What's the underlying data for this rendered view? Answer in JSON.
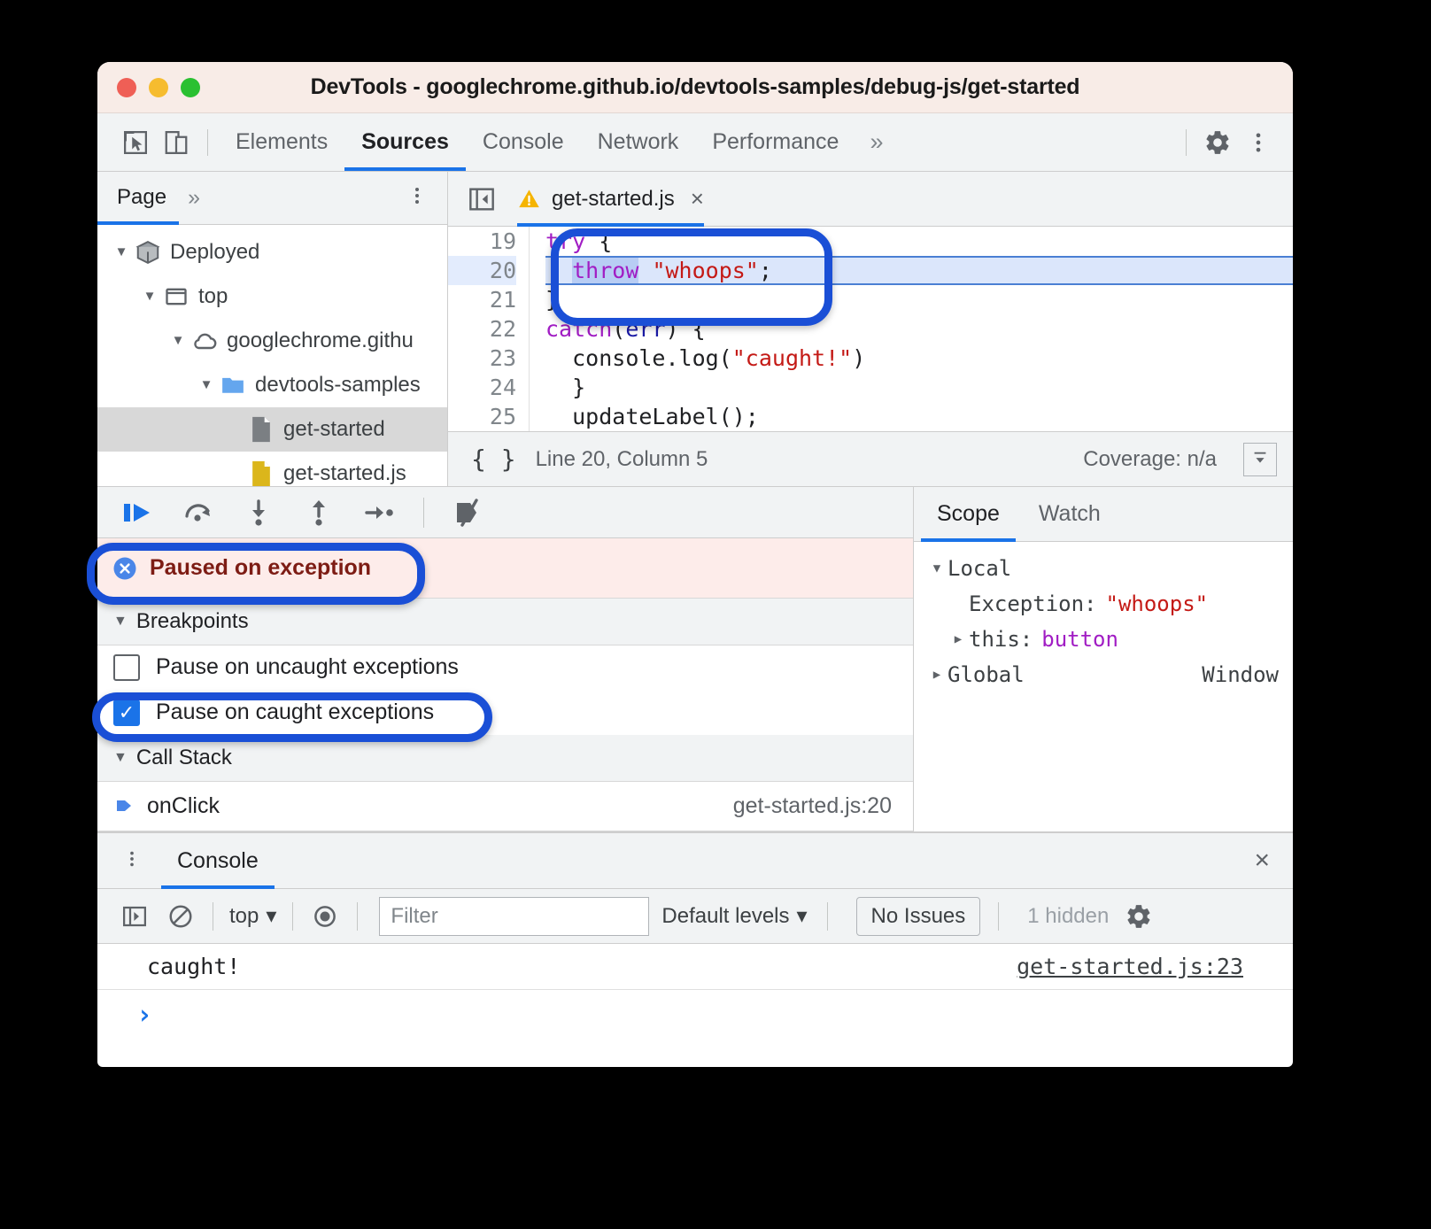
{
  "window": {
    "title": "DevTools - googlechrome.github.io/devtools-samples/debug-js/get-started",
    "traffic_lights": [
      "close-red",
      "minimize-yellow",
      "maximize-green"
    ]
  },
  "main_toolbar": {
    "icons": [
      "inspect-element-icon",
      "device-toolbar-icon"
    ],
    "tabs": [
      {
        "label": "Elements",
        "active": false
      },
      {
        "label": "Sources",
        "active": true
      },
      {
        "label": "Console",
        "active": false
      },
      {
        "label": "Network",
        "active": false
      },
      {
        "label": "Performance",
        "active": false
      }
    ],
    "more_tabs": "»",
    "settings_icon": "gear-icon",
    "menu_icon": "kebab-menu-icon"
  },
  "navigator": {
    "tab": "Page",
    "more": "»",
    "menu_icon": "kebab-menu-icon",
    "tree": [
      {
        "label": "Deployed",
        "icon": "package-icon",
        "depth": 0,
        "expanded": true,
        "selected": false
      },
      {
        "label": "top",
        "icon": "frame-icon",
        "depth": 1,
        "expanded": true,
        "selected": false
      },
      {
        "label": "googlechrome.githu",
        "icon": "cloud-icon",
        "depth": 2,
        "expanded": true,
        "selected": false
      },
      {
        "label": "devtools-samples",
        "icon": "folder-icon",
        "depth": 3,
        "expanded": true,
        "selected": false
      },
      {
        "label": "get-started",
        "icon": "document-icon",
        "depth": 4,
        "expanded": false,
        "selected": true
      },
      {
        "label": "get-started.js",
        "icon": "js-file-icon",
        "depth": 4,
        "expanded": false,
        "selected": false
      }
    ]
  },
  "editor": {
    "sidebar_toggle_icon": "panel-collapse-icon",
    "tab": {
      "warning_icon": "warning-triangle-icon",
      "label": "get-started.js",
      "close": "×"
    },
    "first_line_number": 19,
    "lines": [
      {
        "n": 19,
        "text": "try {",
        "current": false
      },
      {
        "n": 20,
        "text": "  throw \"whoops\";",
        "current": true
      },
      {
        "n": 21,
        "text": "}",
        "current": false
      },
      {
        "n": 22,
        "text": "catch(err) {",
        "current": false
      },
      {
        "n": 23,
        "text": "  console.log(\"caught!\")",
        "current": false
      },
      {
        "n": 24,
        "text": "}",
        "current": false
      },
      {
        "n": 25,
        "text": "updateLabel();",
        "current": false
      }
    ],
    "status": {
      "format_icon": "pretty-print-braces-icon",
      "position": "Line 20, Column 5",
      "coverage": "Coverage: n/a",
      "coverage_toggle_icon": "dropdown-panel-icon"
    }
  },
  "debugger": {
    "toolbar": [
      "resume-script-icon",
      "step-over-icon",
      "step-into-icon",
      "step-out-icon",
      "step-icon",
      "deactivate-breakpoints-icon"
    ],
    "paused": {
      "icon": "error-circle-icon",
      "text": "Paused on exception"
    },
    "breakpoints_section": "Breakpoints",
    "breakpoint_options": [
      {
        "label": "Pause on uncaught exceptions",
        "checked": false
      },
      {
        "label": "Pause on caught exceptions",
        "checked": true
      }
    ],
    "call_stack_section": "Call Stack",
    "call_stack": [
      {
        "icon": "current-frame-arrow-icon",
        "fn": "onClick",
        "location": "get-started.js:20"
      }
    ]
  },
  "scope_pane": {
    "tabs": [
      {
        "label": "Scope",
        "active": true
      },
      {
        "label": "Watch",
        "active": false
      }
    ],
    "entries": [
      {
        "kind": "group",
        "tri": "▼",
        "name": "Local",
        "value": "",
        "right": ""
      },
      {
        "kind": "prop",
        "tri": "",
        "name": "Exception:",
        "value": "\"whoops\"",
        "value_type": "string",
        "right": ""
      },
      {
        "kind": "prop",
        "tri": "▶",
        "name": "this:",
        "value": "button",
        "value_type": "object",
        "right": ""
      },
      {
        "kind": "group",
        "tri": "▶",
        "name": "Global",
        "value": "",
        "right": "Window"
      }
    ]
  },
  "drawer": {
    "menu_icon": "kebab-menu-icon",
    "tab": "Console",
    "close": "×",
    "toolbar": {
      "sidebar_icon": "console-sidebar-icon",
      "clear_icon": "clear-console-icon",
      "context": "top",
      "context_caret": "▾",
      "eye_icon": "live-expression-icon",
      "filter_placeholder": "Filter",
      "levels_label": "Default levels",
      "levels_caret": "▾",
      "issues_label": "No Issues",
      "hidden_label": "1 hidden",
      "settings_icon": "gear-icon"
    },
    "messages": [
      {
        "text": "caught!",
        "link": "get-started.js:23"
      }
    ],
    "prompt": "›"
  },
  "annotations": {
    "colors": {
      "highlight": "#1a4fd6"
    },
    "regions": [
      "code-try-throw-block",
      "paused-on-exception-banner",
      "pause-on-caught-exceptions-checkbox"
    ]
  }
}
